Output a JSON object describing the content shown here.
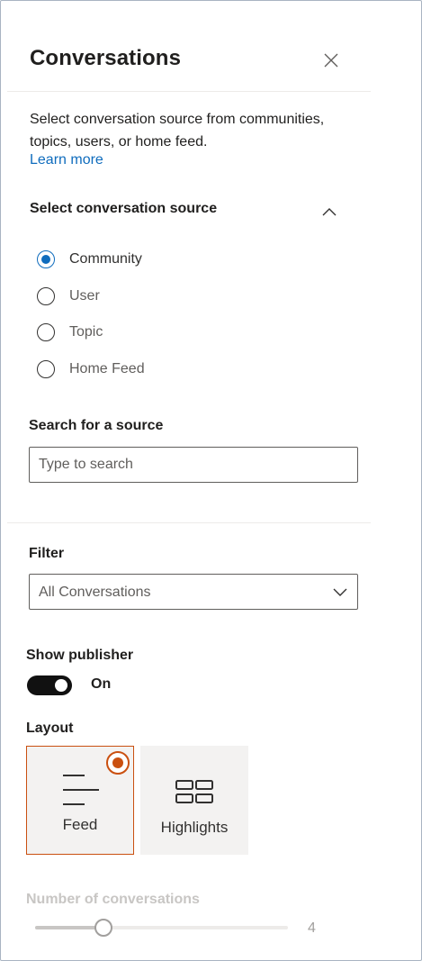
{
  "panel": {
    "title": "Conversations",
    "close_icon": "close-icon"
  },
  "intro": {
    "description": "Select conversation source from communities, topics, users, or home feed.",
    "learn_more": "Learn more"
  },
  "source": {
    "heading": "Select conversation source",
    "collapse_icon": "chevron-up-icon",
    "options": [
      {
        "label": "Community",
        "selected": true
      },
      {
        "label": "User",
        "selected": false
      },
      {
        "label": "Topic",
        "selected": false
      },
      {
        "label": "Home Feed",
        "selected": false
      }
    ]
  },
  "search": {
    "heading": "Search for a source",
    "placeholder": "Type to search",
    "value": ""
  },
  "filter": {
    "heading": "Filter",
    "selected": "All Conversations",
    "chevron_icon": "chevron-down-icon"
  },
  "publisher": {
    "heading": "Show publisher",
    "state_label": "On",
    "enabled": true
  },
  "layout": {
    "heading": "Layout",
    "options": [
      {
        "label": "Feed",
        "icon": "feed-lines-icon",
        "selected": true
      },
      {
        "label": "Highlights",
        "icon": "highlights-grid-icon",
        "selected": false
      }
    ]
  },
  "conversations": {
    "heading": "Number of conversations",
    "value": "4",
    "fraction": 0.27
  },
  "colors": {
    "accent_blue": "#0f6cbd",
    "selected_orange": "#ca5010",
    "toggle_on": "#111111",
    "disabled_text": "#c8c6c4"
  }
}
